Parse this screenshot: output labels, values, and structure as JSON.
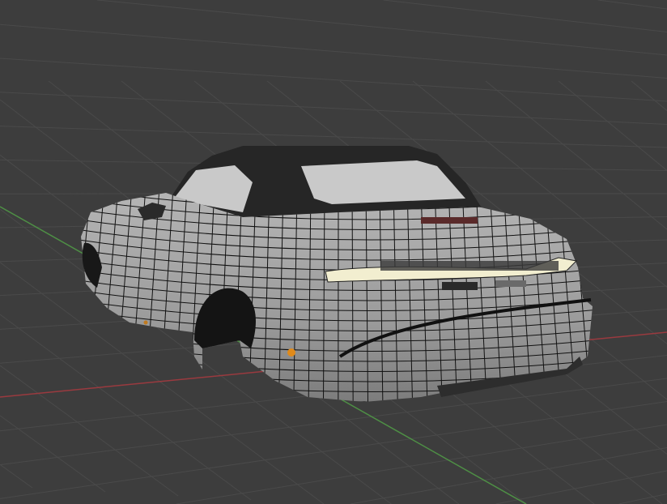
{
  "viewport": {
    "background": "#3d3d3d",
    "grid_color": "#4a4a4a",
    "x_axis_color": "#9a3a3f",
    "y_axis_color": "#4e8f45"
  },
  "model": {
    "body_color": "#a8a8a8",
    "wire_color": "#111111",
    "roof_color": "#262626",
    "glass_color": "#c9c9c9",
    "taillight_color": "#f2eed0",
    "indicator_color": "#e08a1a"
  }
}
